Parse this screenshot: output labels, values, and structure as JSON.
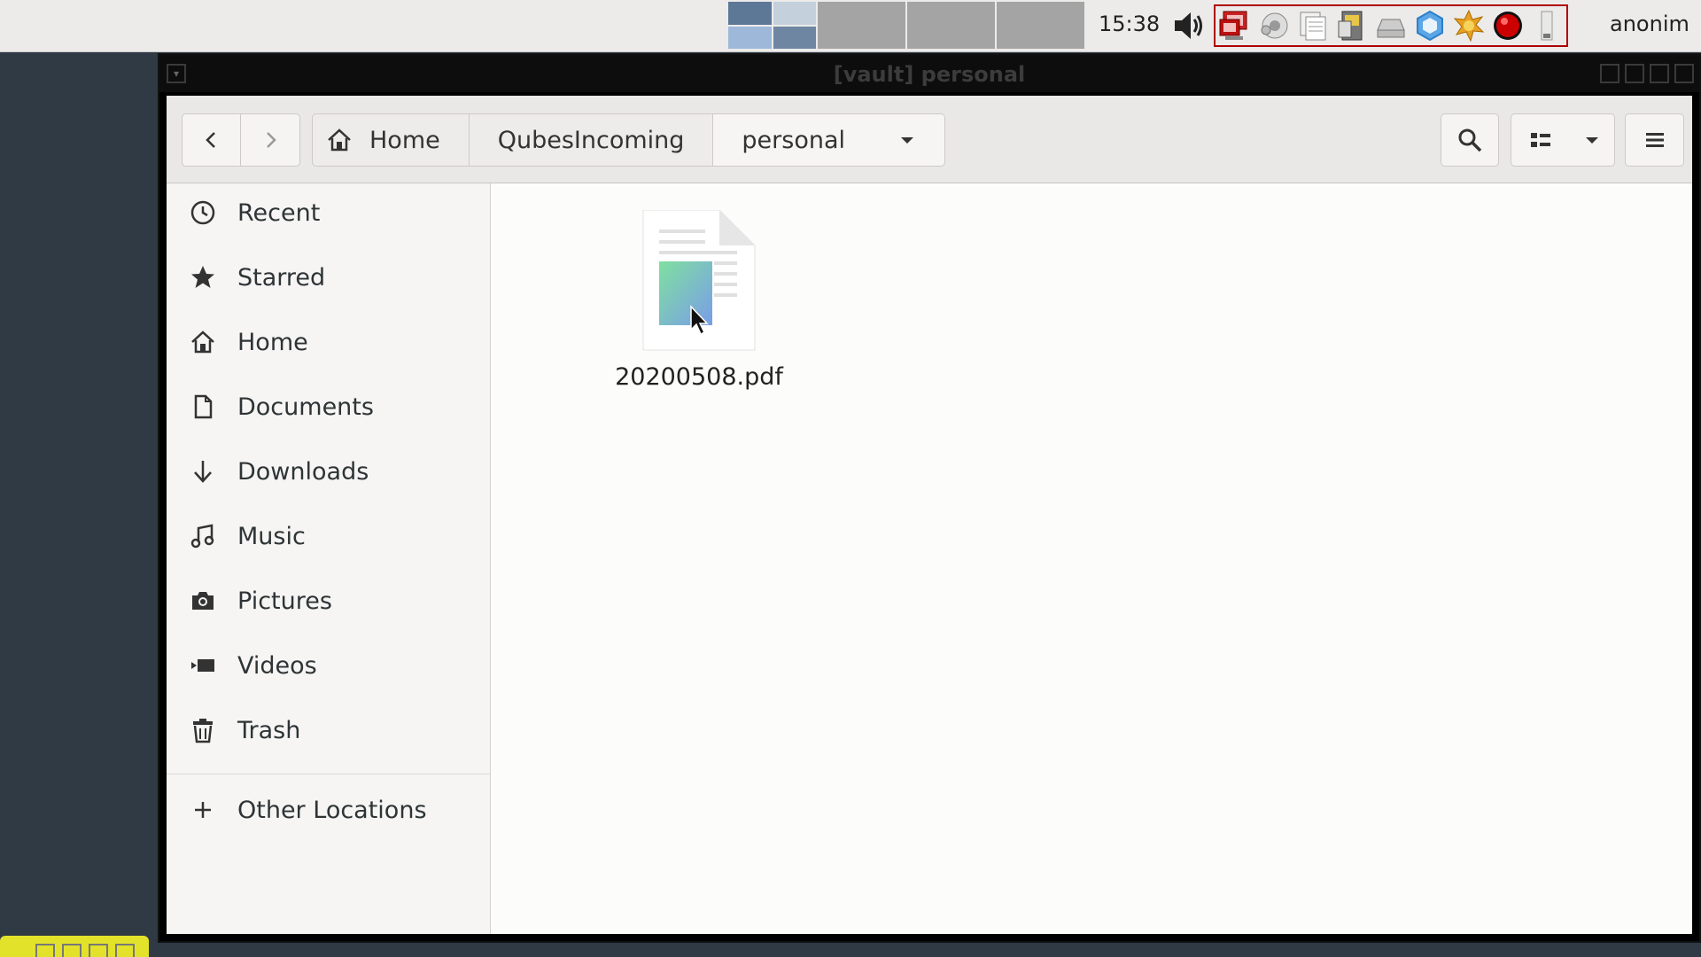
{
  "panel": {
    "clock": "15:38",
    "user": "anonim",
    "tray_icons": [
      "volume-icon",
      "qubes-domains-icon",
      "network-icon",
      "clipboard-icon",
      "devices-icon",
      "disk-icon",
      "qubes-updater-icon",
      "settings-sun-icon",
      "red-record-icon",
      "battery-icon"
    ]
  },
  "window": {
    "title": "[vault] personal"
  },
  "pathbar": {
    "crumbs": [
      "Home",
      "QubesIncoming",
      "personal"
    ]
  },
  "sidebar": {
    "items": [
      {
        "label": "Recent",
        "icon": "clock-icon"
      },
      {
        "label": "Starred",
        "icon": "star-icon"
      },
      {
        "label": "Home",
        "icon": "home-icon"
      },
      {
        "label": "Documents",
        "icon": "document-icon"
      },
      {
        "label": "Downloads",
        "icon": "download-icon"
      },
      {
        "label": "Music",
        "icon": "music-icon"
      },
      {
        "label": "Pictures",
        "icon": "camera-icon"
      },
      {
        "label": "Videos",
        "icon": "video-icon"
      },
      {
        "label": "Trash",
        "icon": "trash-icon"
      }
    ],
    "other_locations": "Other Locations"
  },
  "files": [
    {
      "name": "20200508.pdf",
      "type": "pdf"
    }
  ],
  "colors": {
    "panel_bg": "#ecebea",
    "desktop_bg": "#2f3a44",
    "headerbar_bg": "#e9e8e6",
    "sidebar_bg": "#f6f5f4",
    "qubes_frame": "#b00000"
  }
}
